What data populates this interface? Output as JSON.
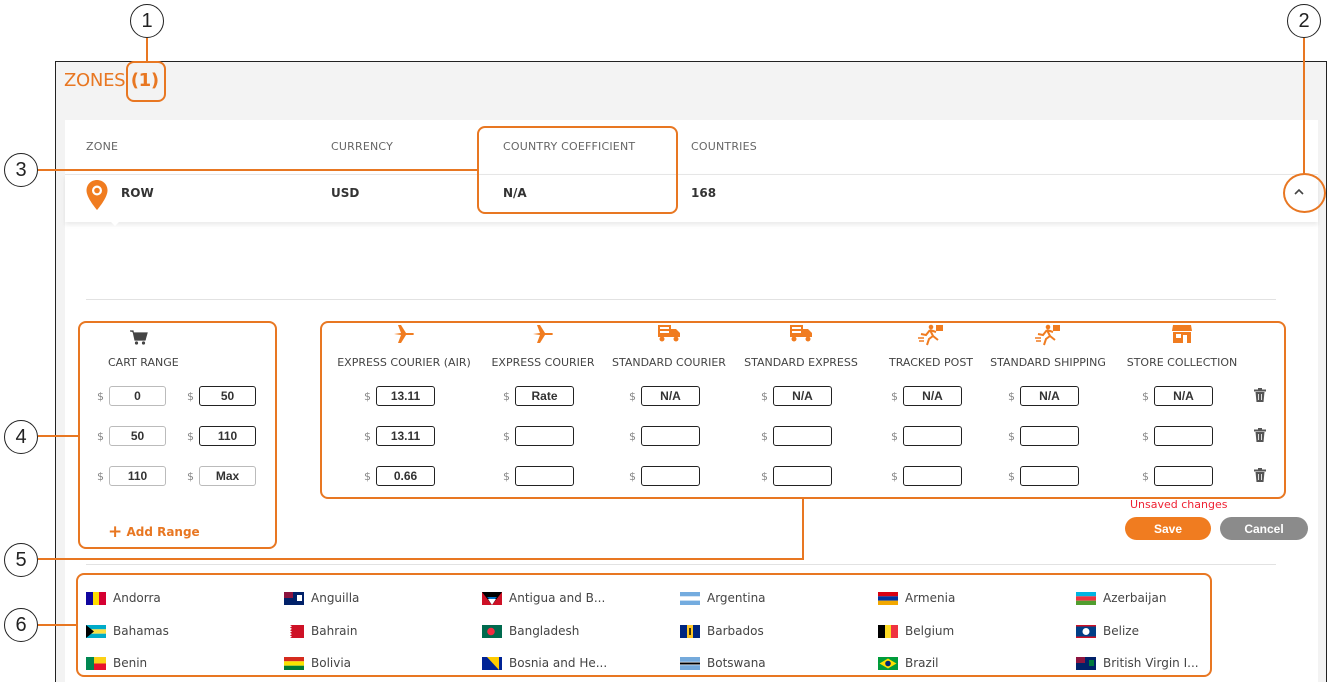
{
  "callouts": [
    "1",
    "2",
    "3",
    "4",
    "5",
    "6"
  ],
  "title": {
    "prefix": "ZONES",
    "count": "(1)"
  },
  "headers": {
    "zone": "ZONE",
    "currency": "CURRENCY",
    "coefficient": "COUNTRY COEFFICIENT",
    "countries": "COUNTRIES"
  },
  "zone_row": {
    "zone": "ROW",
    "currency": "USD",
    "coefficient": "N/A",
    "countries": "168"
  },
  "cart_range": {
    "label": "CART RANGE",
    "currency_symbol": "$",
    "rows": [
      {
        "from": "0",
        "to": "50"
      },
      {
        "from": "50",
        "to": "110"
      },
      {
        "from": "110",
        "to": "Max"
      }
    ],
    "add_label": "Add Range"
  },
  "methods": [
    {
      "label": "EXPRESS COURIER (AIR)",
      "icon": "plane-icon",
      "values": [
        "13.11",
        "13.11",
        "0.66"
      ]
    },
    {
      "label": "EXPRESS COURIER",
      "icon": "plane-icon",
      "values": [
        "Rate",
        "",
        ""
      ]
    },
    {
      "label": "STANDARD COURIER",
      "icon": "truck-icon",
      "values": [
        "N/A",
        "",
        ""
      ]
    },
    {
      "label": "STANDARD EXPRESS",
      "icon": "truck-icon",
      "values": [
        "N/A",
        "",
        ""
      ]
    },
    {
      "label": "TRACKED POST",
      "icon": "runner-icon",
      "values": [
        "N/A",
        "",
        ""
      ]
    },
    {
      "label": "STANDARD SHIPPING",
      "icon": "runner-icon",
      "values": [
        "N/A",
        "",
        ""
      ]
    },
    {
      "label": "STORE COLLECTION",
      "icon": "store-icon",
      "values": [
        "N/A",
        "",
        ""
      ]
    }
  ],
  "unsaved": "Unsaved changes",
  "buttons": {
    "save": "Save",
    "cancel": "Cancel"
  },
  "countries": [
    [
      "Andorra",
      "Anguilla",
      "Antigua and B...",
      "Argentina",
      "Armenia",
      "Azerbaijan"
    ],
    [
      "Bahamas",
      "Bahrain",
      "Bangladesh",
      "Barbados",
      "Belgium",
      "Belize"
    ],
    [
      "Benin",
      "Bolivia",
      "Bosnia and He...",
      "Botswana",
      "Brazil",
      "British Virgin I..."
    ]
  ],
  "colors": {
    "accent": "#e87722",
    "save": "#f07c20",
    "cancel": "#8b8b8b",
    "unsaved": "#e22233"
  }
}
